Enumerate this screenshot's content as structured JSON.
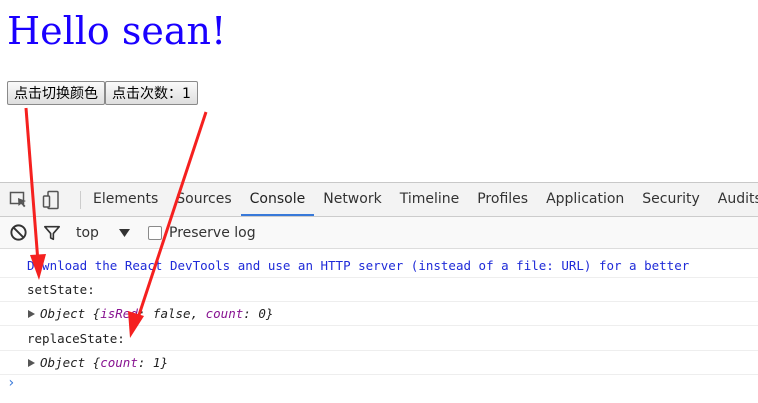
{
  "page": {
    "heading": "Hello sean!",
    "buttons": {
      "toggle_color": "点击切换颜色",
      "click_count": "点击次数：1"
    }
  },
  "devtools": {
    "tabs": [
      "Elements",
      "Sources",
      "Console",
      "Network",
      "Timeline",
      "Profiles",
      "Application",
      "Security",
      "Audits"
    ],
    "active_tab": "Console",
    "filter": {
      "context": "top",
      "preserve_log_label": "Preserve log"
    },
    "console": {
      "devtools_msg": "Download the React DevTools and use an HTTP server (instead of a file: URL) for a better",
      "set_state_label": "setState:",
      "obj1": {
        "prefix": "Object {",
        "k1": "isRed",
        "v1": "false",
        "k2": "count",
        "v2": "0",
        "suffix": "}"
      },
      "replace_state_label": "replaceState:",
      "obj2": {
        "prefix": "Object {",
        "k1": "count",
        "v1": "1",
        "suffix": "}"
      },
      "prompt": "›"
    }
  },
  "colors": {
    "heading": "#1a00ff",
    "arrow": "#f5201f",
    "active_tab": "#3879d9"
  },
  "icons": [
    "inspect-icon",
    "device-toggle-icon",
    "clear-console-icon",
    "filter-icon",
    "dropdown-triangle-icon",
    "expand-triangle-icon"
  ]
}
